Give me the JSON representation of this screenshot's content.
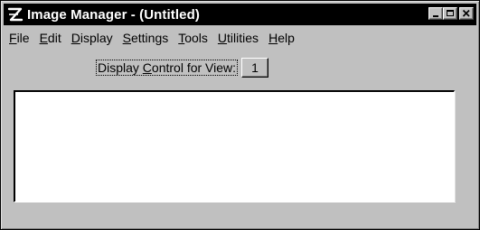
{
  "window": {
    "title": "Image Manager - (Untitled)",
    "app_icon": "image-manager-app-icon",
    "controls": [
      "minimize-icon",
      "maximize-icon",
      "close-icon"
    ]
  },
  "menubar": {
    "items": [
      {
        "label": "File",
        "accel": "F",
        "rest": "ile"
      },
      {
        "label": "Edit",
        "accel": "E",
        "rest": "dit"
      },
      {
        "label": "Display",
        "accel": "D",
        "rest": "isplay"
      },
      {
        "label": "Settings",
        "accel": "S",
        "rest": "ettings"
      },
      {
        "label": "Tools",
        "accel": "T",
        "rest": "ools"
      },
      {
        "label": "Utilities",
        "accel": "U",
        "rest": "tilities"
      },
      {
        "label": "Help",
        "accel": "H",
        "rest": "elp"
      }
    ]
  },
  "display_control": {
    "label_pre": "Display ",
    "label_accel": "C",
    "label_post": "ontrol for View:",
    "view_number": "1"
  },
  "colors": {
    "face": "#c0c0c0",
    "titlebar": "#000000",
    "title_text": "#ffffff",
    "listbox": "#ffffff"
  }
}
